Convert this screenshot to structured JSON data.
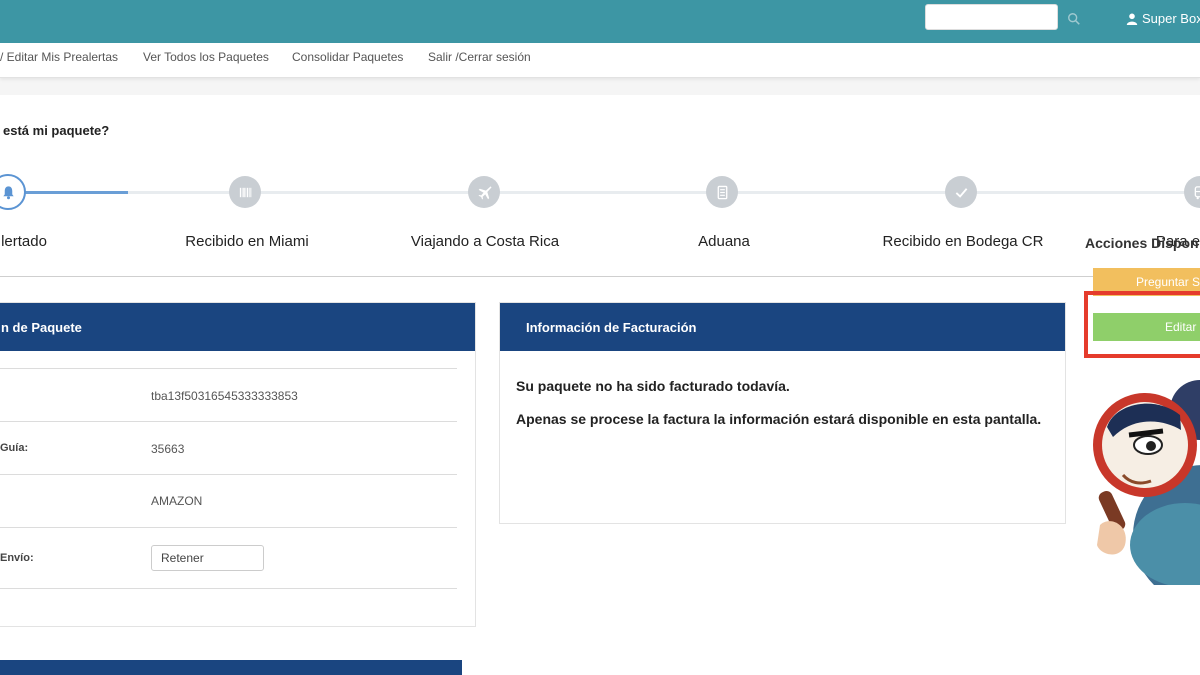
{
  "header": {
    "search_placeholder": "",
    "user_name": "Super Box"
  },
  "nav": {
    "items": [
      "/ Editar Mis Prealertas",
      "Ver Todos los Paquetes",
      "Consolidar Paquetes",
      "Salir /Cerrar sesión"
    ]
  },
  "page": {
    "title": "está mi paquete?"
  },
  "tracker": {
    "steps": [
      {
        "label": "lertado",
        "icon": "bell-icon"
      },
      {
        "label": "Recibido en Miami",
        "icon": "barcode-icon"
      },
      {
        "label": "Viajando a Costa Rica",
        "icon": "airplane-icon"
      },
      {
        "label": "Aduana",
        "icon": "document-icon"
      },
      {
        "label": "Recibido en Bodega CR",
        "icon": "check-icon"
      },
      {
        "label": "Para e",
        "icon": "bus-icon"
      }
    ],
    "current_step": 0
  },
  "package_panel": {
    "title": "n de Paquete",
    "rows": [
      {
        "label": "",
        "value": "tba13f50316545333333853"
      },
      {
        "label": "Guía:",
        "value": "35663"
      },
      {
        "label": "",
        "value": "AMAZON"
      },
      {
        "label": "Envío:",
        "select_value": "Retener"
      }
    ]
  },
  "billing_panel": {
    "title": "Información de Facturación",
    "line1": "Su paquete no ha sido facturado todavía.",
    "line2": "Apenas se procese la factura la información estará disponible en esta pantalla."
  },
  "actions": {
    "title": "Acciones Dispon",
    "ask_button": "Preguntar S",
    "edit_button": "Editar"
  },
  "colors": {
    "topbar": "#3d96a4",
    "panel_header": "#1a4580",
    "active_step": "#5b94d3",
    "ask_button": "#f2bf5e",
    "edit_button": "#8fcf6a",
    "highlight": "#e53b2c"
  }
}
